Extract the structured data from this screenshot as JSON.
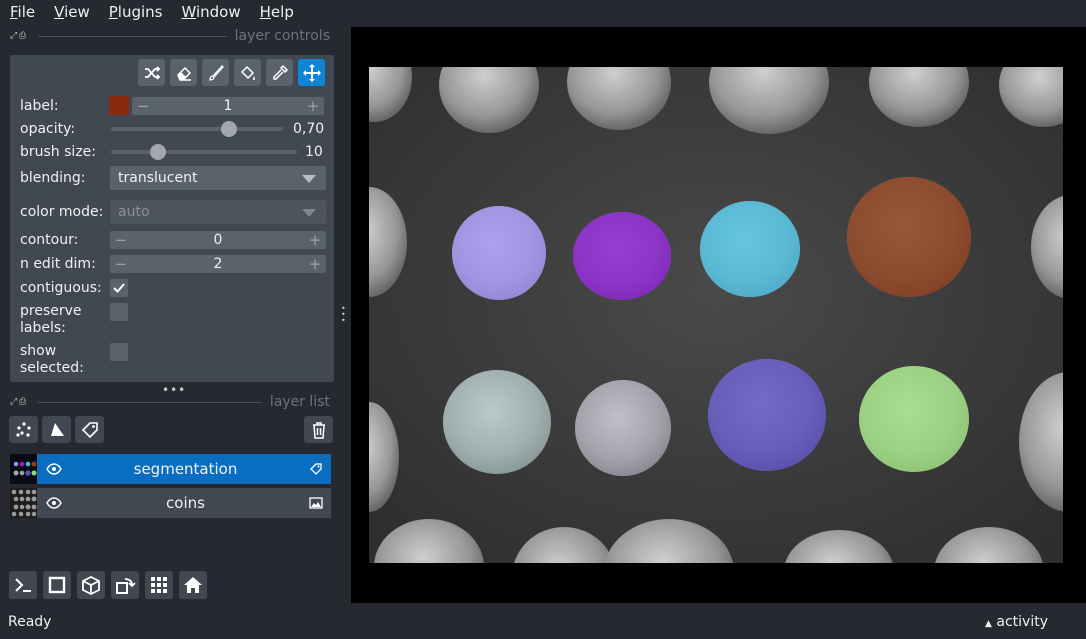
{
  "menu": [
    "File",
    "View",
    "Plugins",
    "Window",
    "Help"
  ],
  "layer_controls": {
    "title": "layer controls",
    "label": {
      "caption": "label:",
      "value": "1",
      "color": "#8b2a0a"
    },
    "opacity": {
      "caption": "opacity:",
      "value_text": "0,70",
      "value": 0.7
    },
    "brush_size": {
      "caption": "brush size:",
      "value_text": "10",
      "value": 10
    },
    "blending": {
      "caption": "blending:",
      "value": "translucent"
    },
    "color_mode": {
      "caption": "color mode:",
      "value": "auto"
    },
    "contour": {
      "caption": "contour:",
      "value": "0"
    },
    "n_edit_dim": {
      "caption": "n edit dim:",
      "value": "2"
    },
    "contiguous": {
      "caption": "contiguous:",
      "checked": true
    },
    "preserve_labels": {
      "caption_1": "preserve",
      "caption_2": "labels:",
      "checked": false
    },
    "show_selected": {
      "caption_1": "show",
      "caption_2": "selected:",
      "checked": false
    },
    "tools": [
      "shuffle-icon",
      "eraser-icon",
      "paintbrush-icon",
      "fill-bucket-icon",
      "color-picker-icon",
      "move-icon"
    ],
    "active_tool": "move-icon"
  },
  "layer_list": {
    "title": "layer list",
    "layers": [
      {
        "name": "segmentation",
        "selected": true,
        "type_icon": "label-tag-icon"
      },
      {
        "name": "coins",
        "selected": false,
        "type_icon": "image-icon"
      }
    ]
  },
  "status": {
    "ready": "Ready",
    "activity": "activity"
  },
  "colors": {
    "background": "#262930",
    "panel": "#414851",
    "control": "#5a626c",
    "accent": "#0f85d8",
    "selected_layer": "#0a6ec0"
  }
}
